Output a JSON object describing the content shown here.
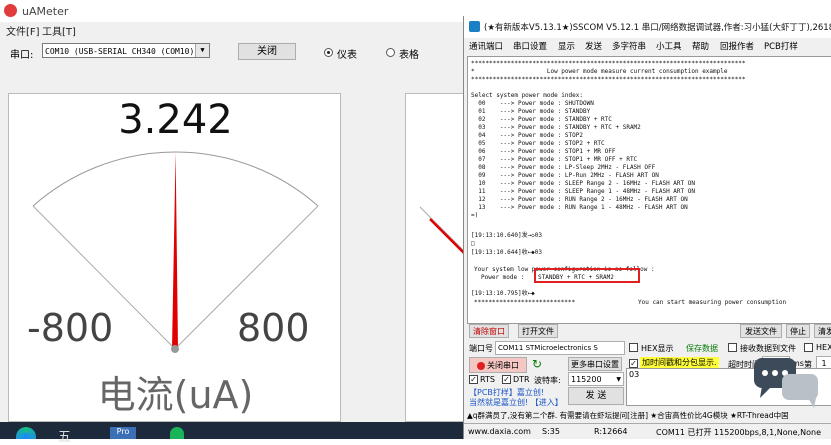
{
  "uameter": {
    "title": "uAMeter",
    "menu": [
      "文件[F]",
      "工具[T]"
    ],
    "port_label": "串口:",
    "port_value": "COM10 (USB-SERIAL CH340 (COM10))",
    "close_button": "关闭",
    "radio_gauge": "仪表",
    "radio_table": "表格",
    "gauge": {
      "value": "3.242",
      "min_label": "-800",
      "max_label": "800",
      "unit_label": "电流(uA)",
      "level_fraction": 0.502
    }
  },
  "sscom": {
    "title": "(★有新版本V5.13.1★)SSCOM V5.12.1 串口/网络数据调试器,作者:习小猛(大虾丁丁),2618058@",
    "menu": [
      "通讯端口",
      "串口设置",
      "显示",
      "发送",
      "多字符串",
      "小工具",
      "帮助",
      "回报作者",
      "PCB打样"
    ],
    "terminal_lines": [
      "****************************************************************************",
      "*                    Low power mode measure current consumption example",
      "****************************************************************************",
      "",
      "Select system power mode index:",
      "  00    ---> Power mode : SHUTDOWN",
      "  01    ---> Power mode : STANDBY",
      "  02    ---> Power mode : STANDBY + RTC",
      "  03    ---> Power mode : STANDBY + RTC + SRAM2",
      "  04    ---> Power mode : STOP2",
      "  05    ---> Power mode : STOP2 + RTC",
      "  06    ---> Power mode : STOP1 + MR OFF",
      "  07    ---> Power mode : STOP1 + MR OFF + RTC",
      "  08    ---> Power mode : LP-Sleep 2MHz - FLASH OFF",
      "  09    ---> Power mode : LP-Run 2MHz - FLASH ART ON",
      "  10    ---> Power mode : SLEEP Range 2 - 16MHz - FLASH ART ON",
      "  11    ---> Power mode : SLEEP Range 1 - 48MHz - FLASH ART ON",
      "  12    ---> Power mode : RUN Range 2 - 16MHz - FLASH ART ON",
      "  13    ---> Power mode : RUN Range 1 - 48MHz - FLASH ART ON",
      "=)"
    ],
    "log_sent": "[19:13:10.640]发→◇03",
    "log_square": "□",
    "log_recv1": "[19:13:10.644]收←◆03",
    "config_line": "Your system low power configuration is as follow :",
    "power_mode_label": "Power mode :",
    "power_mode_value": "STANDBY + RTC + SRAM2",
    "log_recv2": "[19:13:10.795]收←◆",
    "stars_short": "****************************",
    "start_msg": "You can start measuring power consumption",
    "buttons": {
      "clear": "清除窗口",
      "open_file": "打开文件",
      "send_file": "发送文件",
      "stop": "停止",
      "clear_send": "清发",
      "open_port": "关闭串口",
      "more_settings": "更多串口设置",
      "send": "发 送"
    },
    "port_label": "端口号",
    "port_value": "COM11 STMicroelectronics S",
    "hex_display": "HEX显示",
    "save_data": "保存数据",
    "recv_to_file": "接收数据到文件",
    "hex_send": "HEX",
    "timestamp_opt": "加时间戳和分包显示.",
    "timeout_label": "超时时间:",
    "timeout_value": "20",
    "timeout_unit": "ms",
    "byte_label": "第",
    "byte_value": "1",
    "rts": "RTS",
    "dtr": "DTR",
    "baud_label": "波特率:",
    "baud_value": "115200",
    "send_input": "03",
    "promo1": "【PCB打样】嘉立创!",
    "promo2": "当然就是嘉立创! 【进入】",
    "ticker": "▲q群满员了,没有第二个群. 有需要请在虾坛提问[注册] ★合宙高性价比4G模块 ★RT-Thread中国",
    "status": {
      "site": "www.daxia.com",
      "s": "S:35",
      "r": "R:12664",
      "port_state": "COM11 已打开  115200bps,8,1,None,None"
    }
  },
  "colors": {
    "needle": "#e00000",
    "highlight": "#e02020",
    "accent_red_btn": "#f4c7c3"
  }
}
